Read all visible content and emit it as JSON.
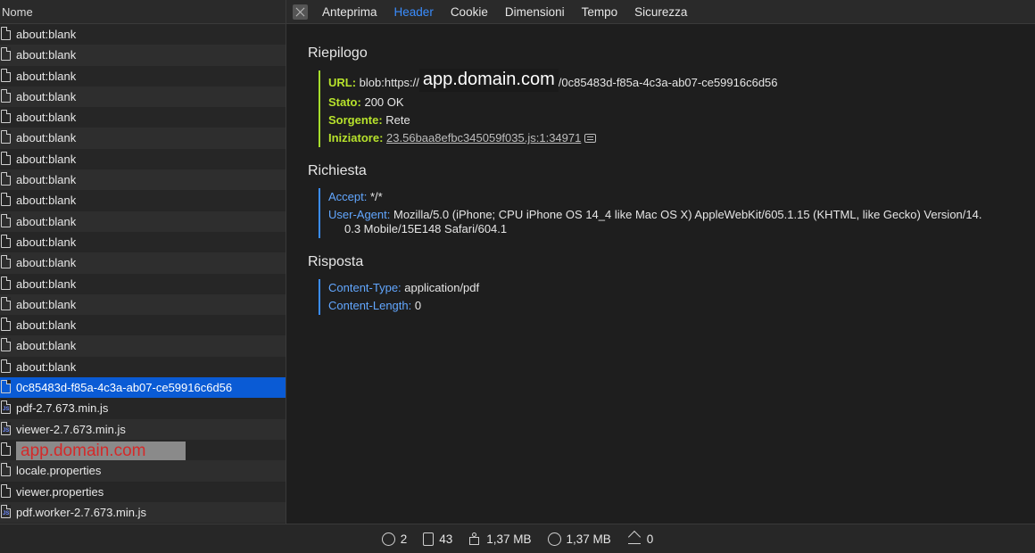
{
  "left_panel": {
    "header": "Nome",
    "items": [
      {
        "label": "about:blank",
        "type": "doc"
      },
      {
        "label": "about:blank",
        "type": "doc"
      },
      {
        "label": "about:blank",
        "type": "doc"
      },
      {
        "label": "about:blank",
        "type": "doc"
      },
      {
        "label": "about:blank",
        "type": "doc"
      },
      {
        "label": "about:blank",
        "type": "doc"
      },
      {
        "label": "about:blank",
        "type": "doc"
      },
      {
        "label": "about:blank",
        "type": "doc"
      },
      {
        "label": "about:blank",
        "type": "doc"
      },
      {
        "label": "about:blank",
        "type": "doc"
      },
      {
        "label": "about:blank",
        "type": "doc"
      },
      {
        "label": "about:blank",
        "type": "doc"
      },
      {
        "label": "about:blank",
        "type": "doc"
      },
      {
        "label": "about:blank",
        "type": "doc"
      },
      {
        "label": "about:blank",
        "type": "doc"
      },
      {
        "label": "about:blank",
        "type": "doc"
      },
      {
        "label": "about:blank",
        "type": "doc"
      },
      {
        "label": "0c85483d-f85a-4c3a-ab07-ce59916c6d56",
        "type": "doc",
        "selected": true
      },
      {
        "label": "pdf-2.7.673.min.js",
        "type": "js"
      },
      {
        "label": "viewer-2.7.673.min.js",
        "type": "js"
      },
      {
        "label": "app.domain.com",
        "type": "doc",
        "redacted": true
      },
      {
        "label": "locale.properties",
        "type": "doc"
      },
      {
        "label": "viewer.properties",
        "type": "doc"
      },
      {
        "label": "pdf.worker-2.7.673.min.js",
        "type": "js"
      }
    ]
  },
  "tabs": {
    "items": [
      "Anteprima",
      "Header",
      "Cookie",
      "Dimensioni",
      "Tempo",
      "Sicurezza"
    ],
    "active": "Header"
  },
  "summary": {
    "title": "Riepilogo",
    "url_key": "URL:",
    "url_prefix": "blob:https://",
    "url_redacted": "app.domain.com",
    "url_suffix": "/0c85483d-f85a-4c3a-ab07-ce59916c6d56",
    "status_key": "Stato:",
    "status_value": "200 OK",
    "source_key": "Sorgente:",
    "source_value": "Rete",
    "initiator_key": "Iniziatore:",
    "initiator_value": "23.56baa8efbc345059f035.js:1:34971"
  },
  "request": {
    "title": "Richiesta",
    "accept_key": "Accept:",
    "accept_value": "*/*",
    "ua_key": "User-Agent:",
    "ua_value_1": "Mozilla/5.0 (iPhone; CPU iPhone OS 14_4 like Mac OS X) AppleWebKit/605.1.15 (KHTML, like Gecko) Version/14.",
    "ua_value_2": "0.3 Mobile/15E148 Safari/604.1"
  },
  "response": {
    "title": "Risposta",
    "ct_key": "Content-Type:",
    "ct_value": "application/pdf",
    "cl_key": "Content-Length:",
    "cl_value": "0"
  },
  "statusbar": {
    "requests": "2",
    "resources": "43",
    "transferred": "1,37 MB",
    "size": "1,37 MB",
    "errors": "0"
  }
}
